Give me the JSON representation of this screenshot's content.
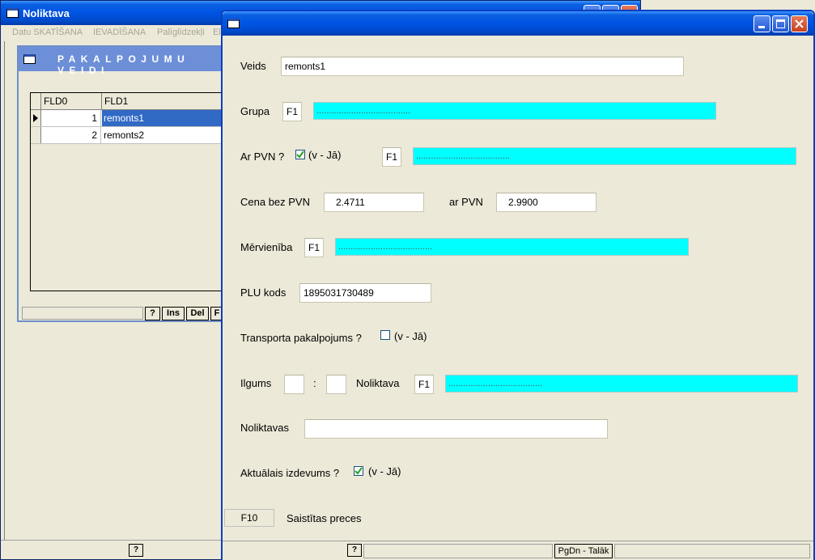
{
  "app": {
    "title": "Noliktava",
    "menu": [
      "Datu SKATĪŠANA",
      "IEVADĪŠANA",
      "Palīglīdzekļi",
      "El"
    ],
    "help_label": "?"
  },
  "pv_window": {
    "title": "PAKALPOJUMU VEIDI",
    "columns": [
      "FLD0",
      "FLD1"
    ],
    "rows": [
      {
        "fld0": "1",
        "fld1": "remonts1"
      },
      {
        "fld0": "2",
        "fld1": "remonts2"
      }
    ],
    "buttons": {
      "help": "?",
      "ins": "Ins",
      "del": "Del",
      "f": "F"
    }
  },
  "form": {
    "veids": {
      "label": "Veids",
      "value": "remonts1"
    },
    "grupa": {
      "label": "Grupa",
      "key": "F1",
      "lookup": "......................................"
    },
    "pvn": {
      "label": "Ar PVN ?",
      "hint": "(v - Jā)",
      "checked": true,
      "key": "F1",
      "lookup": "......................................"
    },
    "cena": {
      "label": "Cena bez PVN",
      "value": "2.4711",
      "ar_label": "ar PVN",
      "ar_value": "2.9900"
    },
    "merv": {
      "label": "Mērvienība",
      "key": "F1",
      "lookup": "......................................"
    },
    "plu": {
      "label": "PLU kods",
      "value": "1895031730489"
    },
    "transp": {
      "label": "Transporta pakalpojums ?",
      "hint": "(v - Jā)",
      "checked": false
    },
    "ilgums": {
      "label": "Ilgums",
      "sep": ":",
      "h": "",
      "m": "",
      "nol_label": "Noliktava",
      "key": "F1",
      "lookup": "......................................"
    },
    "noliktavas": {
      "label": "Noliktavas",
      "value": ""
    },
    "akt": {
      "label": "Aktuālais izdevums ?",
      "hint": "(v - Jā)",
      "checked": true
    },
    "f10": {
      "key": "F10",
      "label": "Saistītas preces"
    },
    "status": {
      "help": "?",
      "pgdn": "PgDn - Talāk"
    }
  },
  "colors": {
    "titlebar": "#0054e3",
    "inactive_titlebar": "#6d8fd8",
    "lookup_bg": "#00ffff",
    "selection": "#316ac5",
    "window_bg": "#ece9d8"
  },
  "icons": [
    "window-icon",
    "minimize-icon",
    "maximize-icon",
    "close-icon",
    "row-pointer-icon",
    "checkmark-icon"
  ]
}
